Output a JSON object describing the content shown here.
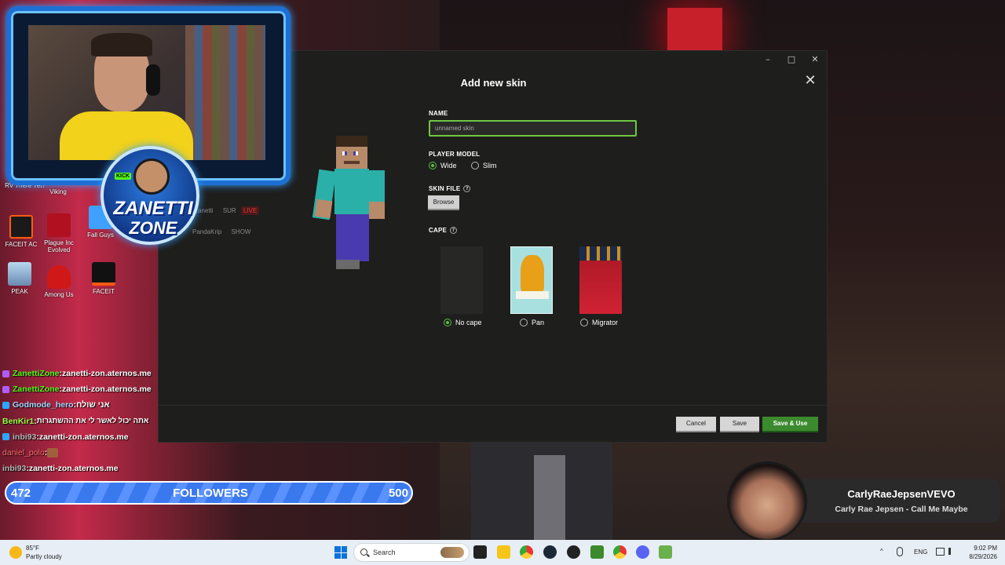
{
  "desktop": {
    "icons": [
      {
        "label": "RV There Yet?"
      },
      {
        "label": "Viking"
      },
      {
        "label": "FACEIT AC"
      },
      {
        "label": "Plague Inc Evolved"
      },
      {
        "label": "Fall Guys"
      },
      {
        "label": "PEAK"
      },
      {
        "label": "Among Us"
      },
      {
        "label": "FACEIT"
      }
    ]
  },
  "stream_overlay": {
    "logo_line1": "ZANETTI",
    "logo_line2": "ZONE",
    "logo_tag": "KICK",
    "mini_items": [
      {
        "name": "zanetti",
        "tag": "SUR",
        "status": "LIVE"
      },
      {
        "name": "PandaKrip",
        "tag": "SHOW"
      }
    ]
  },
  "window": {
    "controls": {
      "minimize": "–",
      "maximize": "□",
      "close": "✕"
    }
  },
  "dialog": {
    "title": "Add new skin",
    "close": "✕",
    "name_label": "NAME",
    "name_value": "unnamed skin",
    "player_model_label": "PLAYER MODEL",
    "player_model_options": [
      {
        "label": "Wide",
        "selected": true
      },
      {
        "label": "Slim",
        "selected": false
      }
    ],
    "skin_file_label": "SKIN FILE",
    "help_glyph": "?",
    "browse_label": "Browse",
    "cape_label": "CAPE",
    "capes": [
      {
        "label": "No cape",
        "selected": true
      },
      {
        "label": "Pan",
        "selected": false
      },
      {
        "label": "Migrator",
        "selected": false
      }
    ],
    "buttons": {
      "cancel": "Cancel",
      "save": "Save",
      "save_use": "Save & Use"
    }
  },
  "chat": [
    {
      "user": "ZanettiZone",
      "sep": " : ",
      "msg": "zanetti-zon.aternos.me",
      "color": "#53fc18",
      "badge": "#b05bff"
    },
    {
      "user": "ZanettiZone",
      "sep": " : ",
      "msg": "zanetti-zon.aternos.me",
      "color": "#53fc18",
      "badge": "#b05bff"
    },
    {
      "user": "Godmode_hero",
      "sep": " : ",
      "msg": "אני שולח",
      "color": "#a8d8ff",
      "badge": "#2aa8ff"
    },
    {
      "user": "BenKir1",
      "sep": " : ",
      "msg": "אתה יכול לאשר לי את ההשתגרות",
      "color": "#9eff4a",
      "badge": ""
    },
    {
      "user": "inbi93",
      "sep": " : ",
      "msg": "zanetti-zon.aternos.me",
      "color": "#b9b9b9",
      "badge": "#2aa8ff"
    },
    {
      "user": "daniel_polo",
      "sep": " : ",
      "msg": "",
      "color": "#ff6a6a",
      "badge": ""
    },
    {
      "user": "inbi93",
      "sep": " : ",
      "msg": "zanetti-zon.aternos.me",
      "color": "#b9b9b9",
      "badge": ""
    }
  ],
  "followers": {
    "current": "472",
    "label": "FOLLOWERS",
    "goal": "500",
    "progress_fraction": 0.944
  },
  "now_playing": {
    "channel": "CarlyRaeJepsenVEVO",
    "track": "Carly Rae Jepsen - Call Me Maybe"
  },
  "taskbar": {
    "temperature": "85°F",
    "condition": "Partly cloudy",
    "search_placeholder": "Search",
    "language": "ENG",
    "time": "9:02 PM",
    "date": "8/29/2026",
    "apps": [
      "file-explorer-icon",
      "folder-icon",
      "chrome-icon",
      "steam-icon",
      "obs-icon",
      "minecraft-icon",
      "chrome-alt-icon",
      "discord-icon",
      "minecraft-launcher-icon"
    ]
  },
  "colors": {
    "accent_green": "#5bbf45",
    "save_use_green": "#3c8a2e",
    "followers_blue": "#3a78ee",
    "frame_blue": "#1c6fd4"
  }
}
